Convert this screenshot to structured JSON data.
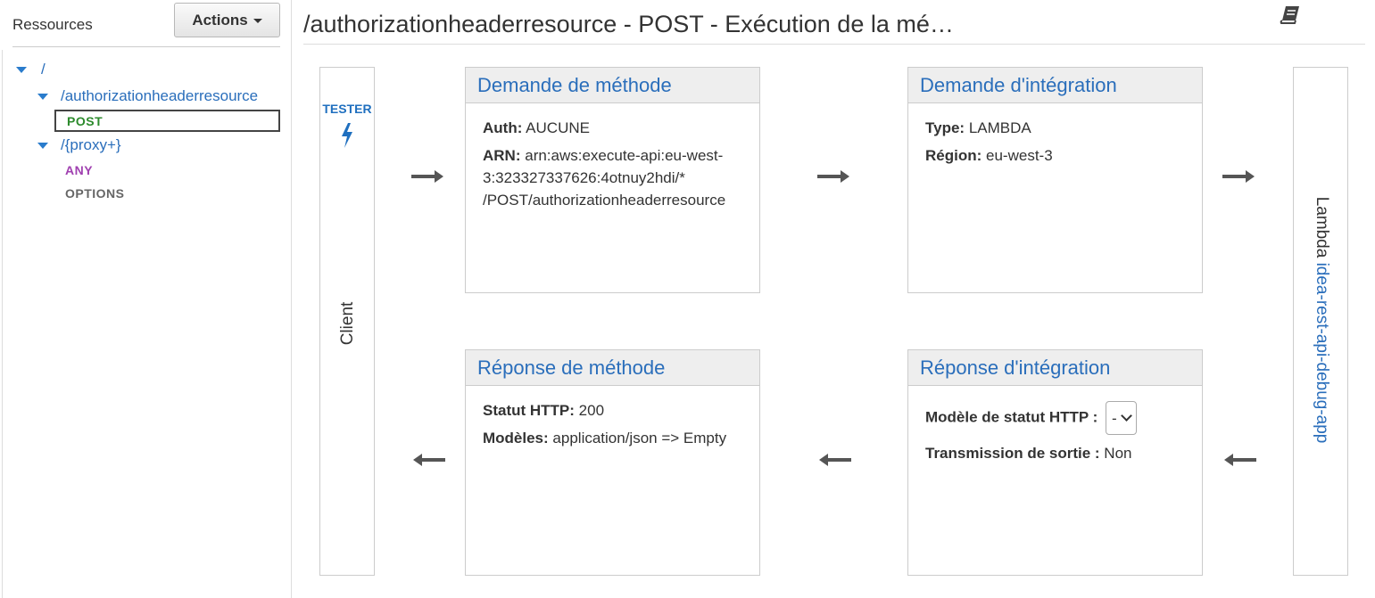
{
  "sidebar": {
    "title": "Ressources",
    "actions_label": "Actions",
    "tree": {
      "root": "/",
      "resource1": "/authorizationheaderresource",
      "resource1_method": "POST",
      "resource2": "/{proxy+}",
      "resource2_methods": [
        "ANY",
        "OPTIONS"
      ]
    }
  },
  "header": {
    "title": "/authorizationheaderresource - POST - Exécution de la mé…"
  },
  "client": {
    "tester_label": "TESTER",
    "label": "Client"
  },
  "lambda": {
    "label": "Lambda",
    "function_name": "idea-rest-api-debug-app"
  },
  "method_request": {
    "title": "Demande de méthode",
    "auth_label": "Auth:",
    "auth_value": "AUCUNE",
    "arn_label": "ARN:",
    "arn_value": "arn:aws:execute-api:eu-west-3:323327337626:4otnuy2hdi/* /POST/authorizationheaderresource"
  },
  "integration_request": {
    "title": "Demande d'intégration",
    "type_label": "Type:",
    "type_value": "LAMBDA",
    "region_label": "Région:",
    "region_value": "eu-west-3"
  },
  "method_response": {
    "title": "Réponse de méthode",
    "status_label": "Statut HTTP:",
    "status_value": "200",
    "models_label": "Modèles:",
    "models_value": "application/json => Empty"
  },
  "integration_response": {
    "title": "Réponse d'intégration",
    "status_model_label": "Modèle de statut HTTP :",
    "status_model_value": "-",
    "passthrough_label": "Transmission de sortie :",
    "passthrough_value": "Non"
  },
  "colors": {
    "link": "#2a6ebb",
    "post": "#2c8a2c",
    "any": "#a040b0",
    "panel_header_bg": "#eeeeee"
  },
  "icons": [
    "caret-down-icon",
    "expand-triangle-icon",
    "book-icon",
    "lightning-bolt-icon",
    "arrow-right-icon",
    "arrow-left-icon",
    "chevron-down-icon"
  ]
}
